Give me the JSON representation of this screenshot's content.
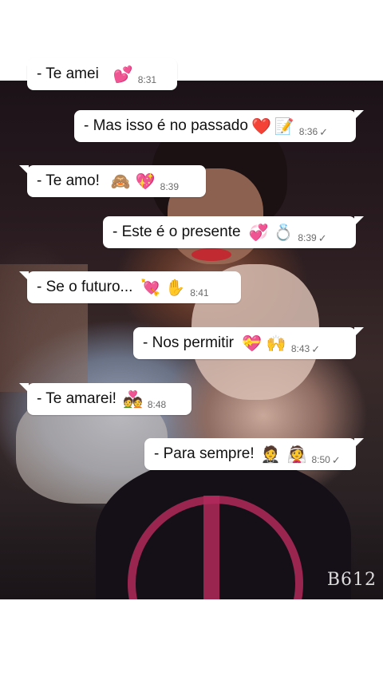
{
  "colors": {
    "bubble": "#ffffff",
    "text": "#111111",
    "time": "#6b6b6b",
    "heart_red": "#e0262b",
    "pink": "#e74c9a"
  },
  "watermark": "B612",
  "messages": [
    {
      "text": "- Te amei",
      "emojis": [
        "💕"
      ],
      "time": "8:31",
      "side": "received",
      "read_check": false
    },
    {
      "text": "- Mas isso é no passado",
      "emojis": [
        "❤️",
        "📝"
      ],
      "time": "8:36",
      "side": "sent",
      "read_check": true
    },
    {
      "text": "-  Te amo!",
      "emojis": [
        "🙈",
        "💖"
      ],
      "time": "8:39",
      "side": "received",
      "read_check": false
    },
    {
      "text": "- Este é o presente",
      "emojis": [
        "💞",
        "💍"
      ],
      "time": "8:39",
      "side": "sent",
      "read_check": true
    },
    {
      "text": "-  Se o futuro...",
      "emojis": [
        "💘",
        "✋"
      ],
      "time": "8:41",
      "side": "received",
      "read_check": false
    },
    {
      "text": "-  Nos permitir",
      "emojis": [
        "💝",
        "🙌"
      ],
      "time": "8:43",
      "side": "sent",
      "read_check": true
    },
    {
      "text": "- Te amarei!",
      "emojis": [
        "💑"
      ],
      "time": "8:48",
      "side": "received",
      "read_check": false
    },
    {
      "text": "- Para sempre!",
      "emojis": [
        "🤵",
        "👰"
      ],
      "time": "8:50",
      "side": "sent",
      "read_check": true
    }
  ],
  "icons": {
    "read_check": "✓"
  }
}
